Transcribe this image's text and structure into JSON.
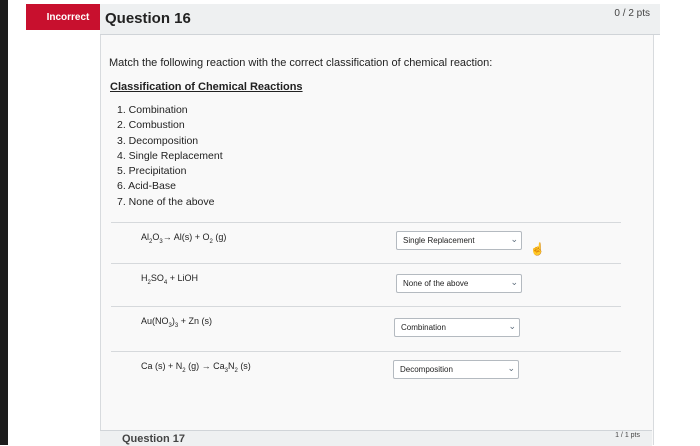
{
  "badge": "Incorrect",
  "question": {
    "title": "Question 16",
    "points": "0 / 2 pts"
  },
  "prompt": "Match the following reaction with the correct classification of chemical reaction:",
  "section_title": "Classification of Chemical Reactions",
  "classifications": [
    "1. Combination",
    "2. Combustion",
    "3. Decomposition",
    "4. Single Replacement",
    "5. Precipitation",
    "6. Acid-Base",
    "7. None of the above"
  ],
  "matches": [
    {
      "reaction": {
        "a": "Al",
        "b": "2",
        "c": "O",
        "d": "3",
        "e": "→ Al(s) + O",
        "f": "2",
        "g": " (g)"
      },
      "answer": "Single Replacement"
    },
    {
      "reaction": {
        "a": "H",
        "b": "2",
        "c": "SO",
        "d": "4",
        "e": " + LiOH"
      },
      "answer": "None of the above"
    },
    {
      "reaction": {
        "a": "Au(NO",
        "b": "3",
        "c": ")",
        "d": "3",
        "e": " + Zn (s)"
      },
      "answer": "Combination"
    },
    {
      "reaction": {
        "a": "Ca (s) + N",
        "b": "2",
        "c": " (g) → Ca",
        "d": "3",
        "e": "N",
        "f": "2",
        "g": " (s)"
      },
      "answer": "Decomposition"
    }
  ],
  "next_question": {
    "title": "Question 17",
    "points": "1 / 1 pts"
  },
  "icons": {
    "dropdown": "chevron-down-icon",
    "cursor": "hand-pointer-icon"
  },
  "colors": {
    "incorrect_badge": "#c8102e"
  }
}
